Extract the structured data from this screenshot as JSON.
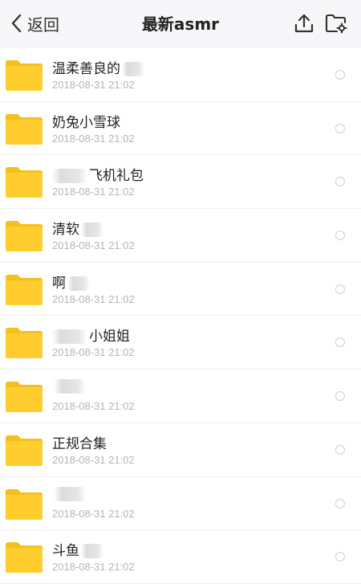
{
  "header": {
    "back_label": "返回",
    "title": "最新asmr",
    "icons": [
      "upload-icon",
      "folder-settings-icon"
    ]
  },
  "folders": [
    {
      "name": "温柔善良的",
      "redacted_after": true,
      "date": "2018-08-31 21:02"
    },
    {
      "name": "奶兔小雪球",
      "date": "2018-08-31 21:02"
    },
    {
      "name": "飞机礼包",
      "redacted_before": true,
      "date": "2018-08-31 21:02"
    },
    {
      "name": "清软",
      "redacted_after": true,
      "date": "2018-08-31 21:02"
    },
    {
      "name": "啊",
      "redacted_after": true,
      "date": "2018-08-31 21:02"
    },
    {
      "name": "小姐姐",
      "redacted_before": true,
      "date": "2018-08-31 21:02"
    },
    {
      "name": "",
      "redacted_after": true,
      "date": "2018-08-31 21:02"
    },
    {
      "name": "正规合集",
      "date": "2018-08-31 21:02"
    },
    {
      "name": "",
      "redacted_after": true,
      "date": "2018-08-31 21:02"
    },
    {
      "name": "斗鱼",
      "redacted_after": true,
      "date": "2018-08-31 21:02"
    }
  ],
  "colors": {
    "folder": "#ffcd2e",
    "folder_tab": "#f5c01e",
    "date": "#b5b5b5",
    "header_bg": "#f7f7f9"
  }
}
